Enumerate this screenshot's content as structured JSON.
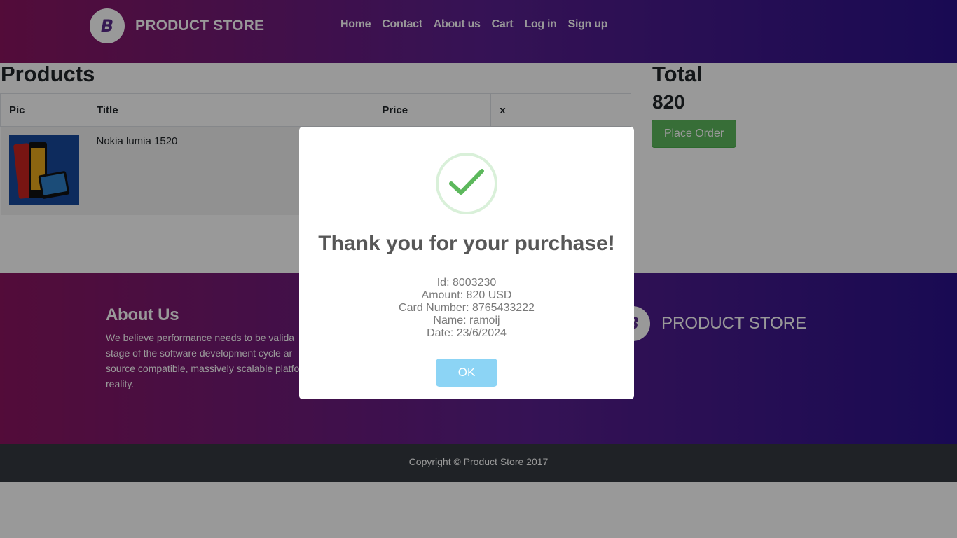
{
  "header": {
    "brand_logo_letter": "B",
    "brand_name": "PRODUCT STORE",
    "nav": [
      "Home",
      "Contact",
      "About us",
      "Cart",
      "Log in",
      "Sign up"
    ]
  },
  "products": {
    "title": "Products",
    "columns": [
      "Pic",
      "Title",
      "Price",
      "x"
    ],
    "rows": [
      {
        "title": "Nokia lumia 1520",
        "price": "",
        "action": ""
      }
    ]
  },
  "cart_total": {
    "label": "Total",
    "value": "820",
    "button": "Place Order"
  },
  "footer": {
    "about_title": "About Us",
    "about_lines": [
      "We believe performance needs to be valida",
      "stage of the software development cycle ar",
      "source compatible, massively scalable platfo",
      "reality."
    ],
    "brand_logo_letter": "B",
    "brand_name": "PRODUCT STORE",
    "copyright": "Copyright © Product Store 2017"
  },
  "modal": {
    "title": "Thank you for your purchase!",
    "lines": [
      "Id: 8003230",
      "Amount: 820 USD",
      "Card Number: 8765433222",
      "Name: ramoij",
      "Date: 23/6/2024"
    ],
    "ok_label": "OK",
    "icon": "success-check-icon"
  },
  "colors": {
    "gradient_start": "#8a1560",
    "gradient_end": "#2a128a",
    "success_green": "#5cb85c",
    "ok_blue": "#8cd4f5"
  }
}
